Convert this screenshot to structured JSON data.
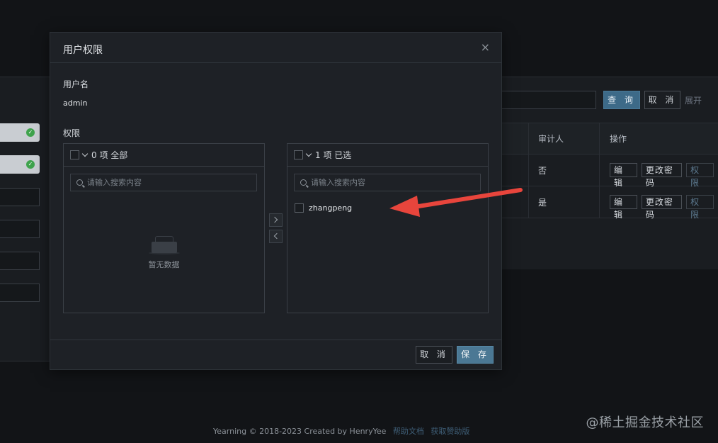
{
  "background": {
    "search_button": "查 询",
    "cancel_button": "取 消",
    "expand_link": "展开",
    "table": {
      "headers": [
        "审计人",
        "操作"
      ],
      "rows": [
        {
          "auditor": "否",
          "actions": [
            "编 辑",
            "更改密码",
            "权 限"
          ]
        },
        {
          "auditor": "是",
          "actions": [
            "编 辑",
            "更改密码",
            "权 限"
          ]
        }
      ]
    }
  },
  "modal": {
    "title": "用户权限",
    "close_icon": "×",
    "username_label": "用户名",
    "username_value": "admin",
    "permission_label": "权限",
    "source_list": {
      "header": "0 项 全部",
      "search_placeholder": "请输入搜索内容",
      "empty_text": "暂无数据",
      "items": []
    },
    "target_list": {
      "header": "1 项 已选",
      "search_placeholder": "请输入搜索内容",
      "items": [
        "zhangpeng"
      ]
    },
    "cancel_button": "取 消",
    "save_button": "保 存"
  },
  "footer": {
    "copyright": "Yearning © 2018-2023 Created by HenryYee",
    "help_link": "帮助文档",
    "sponsor_link": "获取赞助版"
  },
  "watermark": "@稀土掘金技术社区",
  "colors": {
    "accent": "#4b7894",
    "arrow": "#e8453c",
    "success": "#3fa34d"
  }
}
